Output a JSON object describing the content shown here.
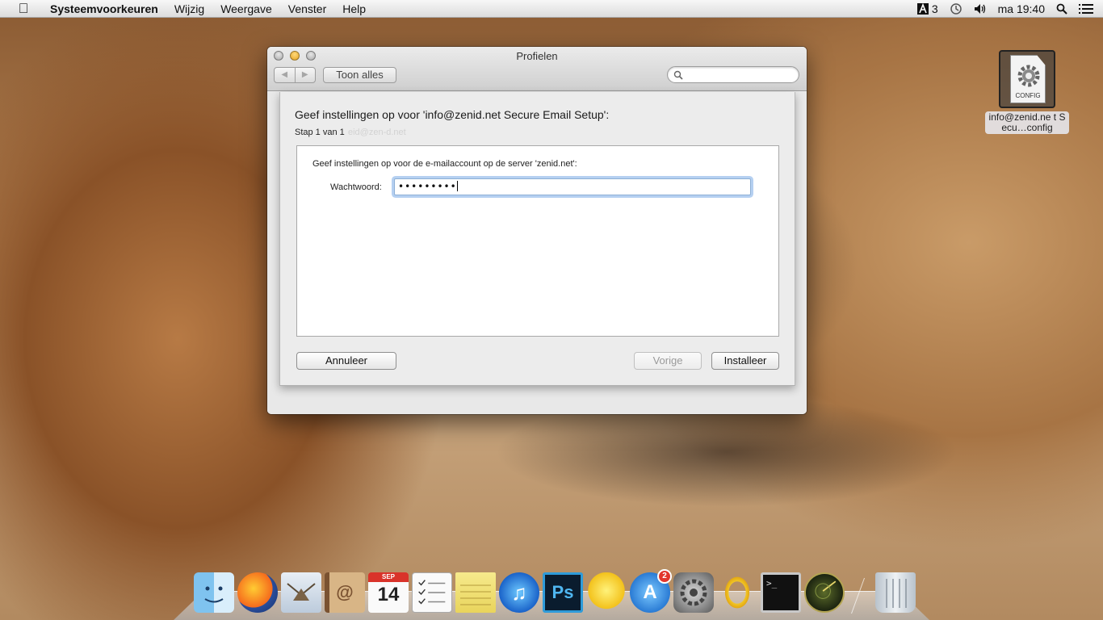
{
  "menubar": {
    "app_name": "Systeemvoorkeuren",
    "items": [
      "Wijzig",
      "Weergave",
      "Venster",
      "Help"
    ],
    "status": {
      "adobe_count": "3",
      "clock": "ma 19:40"
    }
  },
  "desktop_file": {
    "icon_label": "CONFIG",
    "name": "info@zenid.ne t Secu…config"
  },
  "window": {
    "title": "Profielen",
    "show_all": "Toon alles",
    "search_placeholder": ""
  },
  "sheet": {
    "title": "Geef instellingen op voor 'info@zenid.net Secure Email Setup':",
    "step": "Stap 1 van 1",
    "ghost_text": "eid@zen-d.net",
    "instruction": "Geef instellingen op voor de e-mailaccount op de server 'zenid.net':",
    "password_label": "Wachtwoord:",
    "password_value": "•••••••••",
    "cancel_label": "Annuleer",
    "prev_label": "Vorige",
    "install_label": "Installeer"
  },
  "footer": {
    "add": "+",
    "remove": "−",
    "help": "?"
  },
  "dock": {
    "apps": [
      "finder",
      "firefox",
      "mail",
      "contacts",
      "calendar",
      "reminders",
      "notes",
      "itunes",
      "photoshop",
      "cyberduck",
      "app-store",
      "system-preferences",
      "opera",
      "terminal",
      "radar",
      "trash"
    ],
    "calendar_month": "SEP",
    "calendar_day": "14",
    "ps_label": "Ps",
    "terminal_prompt": ">_",
    "appstore_badge": "2"
  }
}
